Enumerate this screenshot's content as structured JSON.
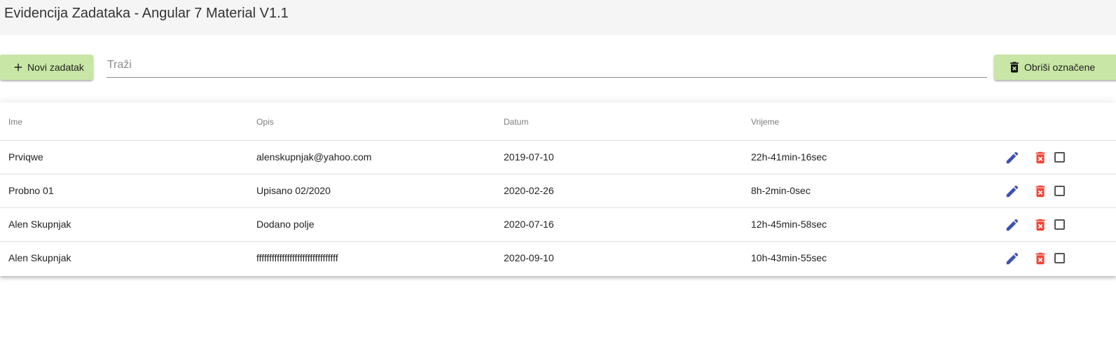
{
  "app": {
    "title": "Evidencija Zadataka - Angular 7 Material V1.1"
  },
  "toolbar": {
    "new_label": "Novi zadatak",
    "search_placeholder": "Traži",
    "search_value": "",
    "delete_selected_label": "Obriši označene",
    "button_color": "#c8e6a5"
  },
  "table": {
    "headers": {
      "name": "Ime",
      "description": "Opis",
      "date": "Datum",
      "time": "Vrijeme"
    },
    "rows": [
      {
        "name": "Prviqwe",
        "description": "alenskupnjak@yahoo.com",
        "date": "2019-07-10",
        "time": "22h-41min-16sec",
        "checked": false
      },
      {
        "name": "Probno 01",
        "description": "Upisano 02/2020",
        "date": "2020-02-26",
        "time": "8h-2min-0sec",
        "checked": false
      },
      {
        "name": "Alen Skupnjak",
        "description": "Dodano polje",
        "date": "2020-07-16",
        "time": "12h-45min-58sec",
        "checked": false
      },
      {
        "name": "Alen Skupnjak",
        "description": "ffffffffffffffffffffffffffffffff",
        "date": "2020-09-10",
        "time": "10h-43min-55sec",
        "checked": false
      }
    ],
    "row_actions": {
      "edit_icon": "pencil-icon",
      "delete_icon": "trash-icon",
      "edit_color": "#3f51b5",
      "delete_color": "#f44336"
    }
  }
}
